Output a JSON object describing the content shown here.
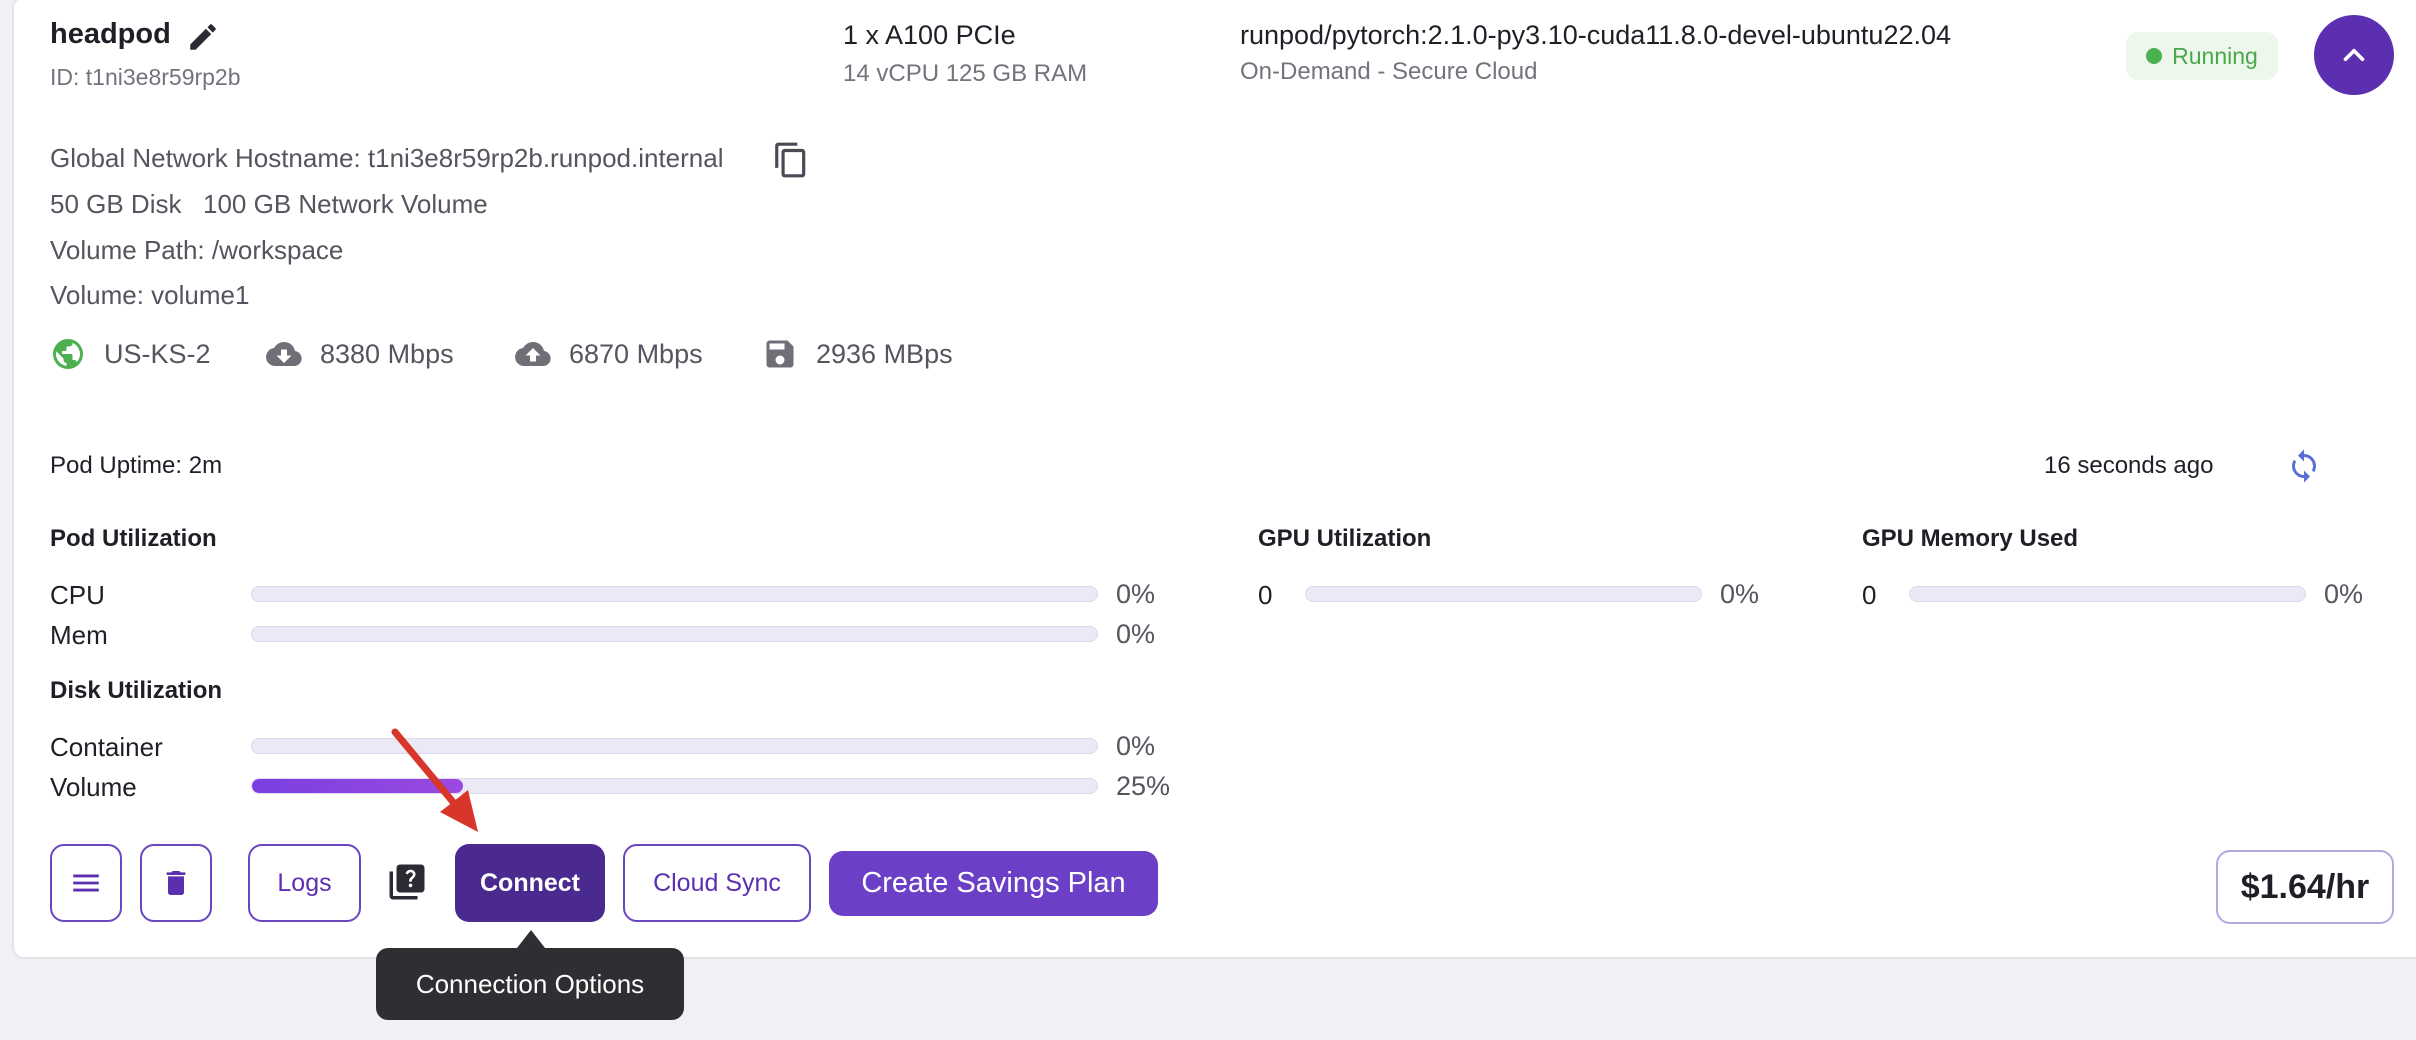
{
  "pod": {
    "name": "headpod",
    "id": "ID: t1ni3e8r59rp2b",
    "gpu": "1 x A100 PCIe",
    "resources": "14 vCPU 125 GB RAM",
    "image": "runpod/pytorch:2.1.0-py3.10-cuda11.8.0-devel-ubuntu22.04",
    "cloud": "On-Demand - Secure Cloud",
    "status": "Running",
    "status_color": "#4cb04f"
  },
  "details": {
    "hostname": "Global Network Hostname: t1ni3e8r59rp2b.runpod.internal",
    "disk": "50 GB Disk",
    "network_volume": "100 GB Network Volume",
    "volume_path": "Volume Path: /workspace",
    "volume": "Volume: volume1"
  },
  "stats": {
    "region": "US-KS-2",
    "download": "8380 Mbps",
    "upload": "6870 Mbps",
    "disk_speed": "2936 MBps"
  },
  "uptime": "Pod Uptime: 2m",
  "refreshed": "16 seconds ago",
  "pod_utilization": {
    "title": "Pod Utilization",
    "rows": [
      {
        "label": "CPU",
        "pct_text": "0%",
        "value": 0
      },
      {
        "label": "Mem",
        "pct_text": "0%",
        "value": 0
      }
    ]
  },
  "disk_utilization": {
    "title": "Disk Utilization",
    "rows": [
      {
        "label": "Container",
        "pct_text": "0%",
        "value": 0
      },
      {
        "label": "Volume",
        "pct_text": "25%",
        "value": 25
      }
    ]
  },
  "gpu_utilization": {
    "title": "GPU Utilization",
    "index": "0",
    "pct_text": "0%",
    "value": 0
  },
  "gpu_memory": {
    "title": "GPU Memory Used",
    "index": "0",
    "pct_text": "0%",
    "value": 0
  },
  "actions": {
    "logs": "Logs",
    "connect": "Connect",
    "cloud_sync": "Cloud Sync",
    "savings_plan": "Create Savings Plan",
    "price": "$1.64/hr"
  },
  "tooltip": "Connection Options",
  "colors": {
    "accent": "#5b2fb0",
    "accent_light": "#6b46c1",
    "annotation_arrow": "#d9362b"
  },
  "icons": [
    "edit-icon",
    "chevron-up-icon",
    "copy-icon",
    "globe-icon",
    "cloud-download-icon",
    "cloud-upload-icon",
    "floppy-disk-icon",
    "refresh-icon",
    "menu-icon",
    "trash-icon",
    "help-docs-icon",
    "annotation-arrow"
  ]
}
